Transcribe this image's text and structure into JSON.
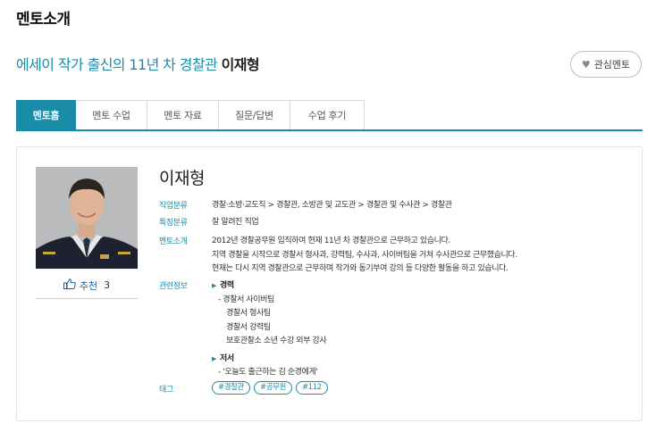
{
  "page": {
    "heading": "멘토소개"
  },
  "mentor": {
    "headline_prefix": "에세이 작가 출신의 11년 차 경찰관",
    "name": "이재형",
    "favorite_label": "관심멘토",
    "recommend_label": "추천",
    "recommend_count": "3"
  },
  "tabs": [
    {
      "label": "멘토홈",
      "active": true
    },
    {
      "label": "멘토 수업",
      "active": false
    },
    {
      "label": "멘토 자료",
      "active": false
    },
    {
      "label": "질문/답변",
      "active": false
    },
    {
      "label": "수업 후기",
      "active": false
    }
  ],
  "details": {
    "job_category_label": "직업분류",
    "job_category": "경찰·소방·교도직 > 경찰관, 소방관 및 교도관 > 경찰관 및 수사관 > 경찰관",
    "feature_category_label": "특징분류",
    "feature_category": "잘 알려진 직업",
    "intro_label": "멘토소개",
    "intro_lines": [
      "2012년 경찰공무원 입직하여 현재 11년 차 경찰관으로 근무하고 있습니다.",
      "지역 경찰을 시작으로 경찰서 형사과, 강력팀, 수사과, 사이버팀을 거쳐 수사관으로 근무했습니다.",
      "현재는 다시 지역 경찰관으로 근무하며 작가와 동기부여 강의 등 다양한 활동을 하고 있습니다."
    ],
    "related_label": "관련정보",
    "career_title": "경력",
    "career_items": [
      "- 경찰서 사이버팀",
      "경찰서 형사팀",
      "경찰서 강력팀",
      "보호관찰소 소년 수강 외부 강사"
    ],
    "books_title": "저서",
    "books_items": [
      "- '오늘도 출근하는 김 순경에게'"
    ],
    "tag_label": "태그",
    "tags": [
      "#경찰관",
      "#공무원",
      "#112"
    ]
  },
  "colors": {
    "accent": "#1b8ca8",
    "photo_bg": "#b7b9bb"
  }
}
